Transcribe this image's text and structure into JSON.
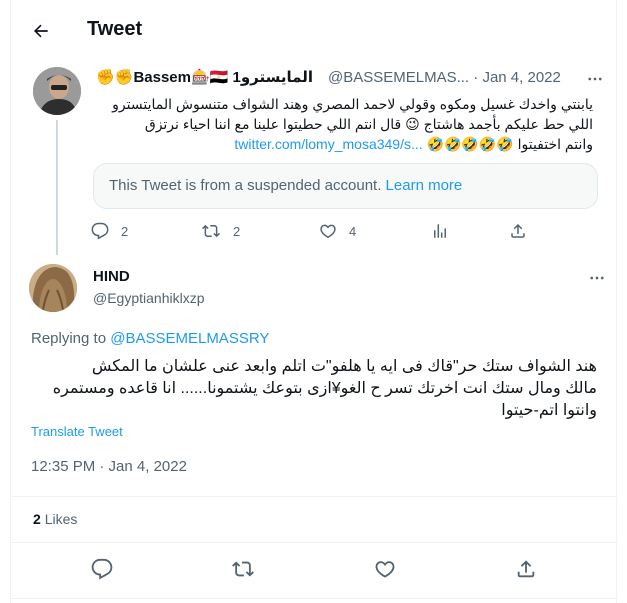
{
  "header": {
    "title": "Tweet"
  },
  "quoted_tweet": {
    "display_name": "المايسترو1 Bassem🎰🇪🇬✊✊",
    "handle": "@BASSEMELMAS...",
    "date": "Jan 4, 2022",
    "line1": "يابنتي واخدك غسيل ومكوه وقولي لاحمد المصري وهند الشواف متنسوش المايتسترو",
    "line2": "اللي حط عليكم بأجمد هاشتاج 😉 قال انتم اللي حطيتوا علينا مع اننا احياء نرتزق",
    "line3_link": "twitter.com/lomy_mosa349/s...",
    "line3_text": "وانتم اختفيتوا 🤣🤣🤣🤣🤣",
    "suspended_text": "This Tweet is from a suspended account.",
    "learn_more": "Learn more",
    "reply_count": "2",
    "retweet_count": "2",
    "like_count": "4"
  },
  "main_tweet": {
    "display_name": "HIND",
    "handle": "@Egyptianhiklxzp",
    "replying_prefix": "Replying to",
    "replying_mention": "@BASSEMELMASSRY",
    "text": "هند الشواف ستك حر\"قاك فى ايه يا هلفو\"ت   اتلم وابعد عنى  علشان ما المكش\nمالك ومال ستك  انت اخرتك تسر ح الغو¥ازى بتوعك يشتمونا...... انا قاعده  ومستمره\nوانتوا اتم-حيتوا",
    "translate": "Translate Tweet",
    "timestamp": "12:35 PM · Jan 4, 2022",
    "likes_count": "2",
    "likes_label": "Likes"
  },
  "colors": {
    "accent": "#1d9bf0",
    "muted": "#536471",
    "text": "#0f1419"
  },
  "icons": [
    "back-arrow-icon",
    "more-icon",
    "reply-icon",
    "retweet-icon",
    "like-icon",
    "views-icon",
    "share-icon"
  ]
}
